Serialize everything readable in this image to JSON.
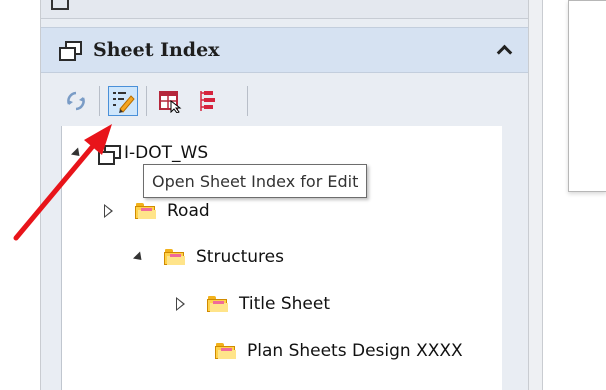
{
  "sheet_index": {
    "title": "Sheet Index",
    "collapse_icon": "chevron-up-icon",
    "toolbar": [
      {
        "icon": "refresh-icon"
      },
      {
        "icon": "edit-sheet-index-icon",
        "active": true
      },
      {
        "icon": "sheet-export-icon"
      },
      {
        "icon": "tree-organize-icon"
      }
    ]
  },
  "tree": {
    "root": {
      "label": "I-DOT_WS",
      "expanded": true
    },
    "items": [
      {
        "label": "Road",
        "expanded": false,
        "icon": "folder-icon"
      },
      {
        "label": "Structures",
        "expanded": true,
        "icon": "folder-icon"
      },
      {
        "label": "Title Sheet",
        "expanded": false,
        "icon": "folder-icon"
      },
      {
        "label": "Plan Sheets Design XXXX",
        "icon": "folder-icon"
      }
    ]
  },
  "tooltip": {
    "text": "Open Sheet Index for Edit"
  },
  "annotation": {
    "color": "#e8141a"
  },
  "colors": {
    "header_bg": "#d6e2f2",
    "panel_bg": "#e9edf3",
    "active_button": "#cfe6fb",
    "folder": "#ffd24a"
  }
}
